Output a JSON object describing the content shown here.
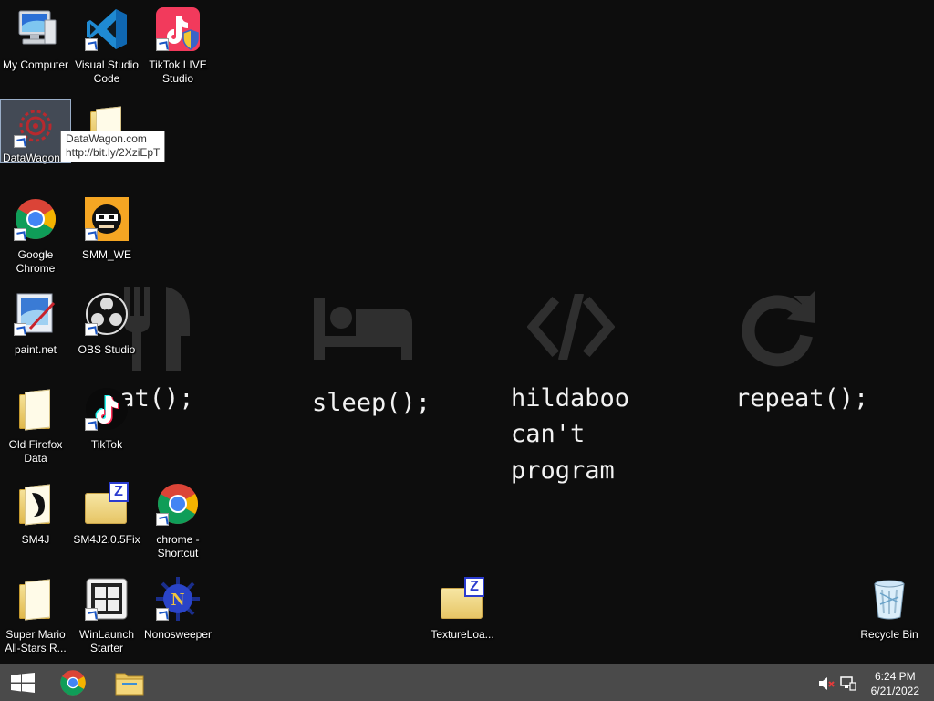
{
  "desktop": {
    "icons": [
      {
        "label": "My Computer",
        "icon": "my-computer-icon"
      },
      {
        "label": "Visual Studio Code",
        "icon": "vscode-icon"
      },
      {
        "label": "TikTok LIVE Studio",
        "icon": "tiktok-live-studio-icon"
      },
      {
        "label": "DataWagon",
        "icon": "datawagon-icon"
      },
      {
        "label": "",
        "icon": "folder-icon"
      },
      {
        "label": "Google Chrome",
        "icon": "chrome-icon"
      },
      {
        "label": "SMM_WE",
        "icon": "smm-we-icon"
      },
      {
        "label": "paint.net",
        "icon": "paint-net-icon"
      },
      {
        "label": "OBS Studio",
        "icon": "obs-studio-icon"
      },
      {
        "label": "Old Firefox Data",
        "icon": "folder-icon"
      },
      {
        "label": "TikTok",
        "icon": "tiktok-icon"
      },
      {
        "label": "SM4J",
        "icon": "folder-icon"
      },
      {
        "label": "SM4J2.0.5Fix",
        "icon": "zip-folder-icon"
      },
      {
        "label": "chrome - Shortcut",
        "icon": "chrome-icon"
      },
      {
        "label": "Super Mario All-Stars R...",
        "icon": "folder-icon"
      },
      {
        "label": "WinLaunch Starter",
        "icon": "winlaunch-icon"
      },
      {
        "label": "Nonosweeper",
        "icon": "nonosweeper-icon"
      },
      {
        "label": "TextureLoa...",
        "icon": "zip-folder-icon"
      },
      {
        "label": "Recycle Bin",
        "icon": "recycle-bin-icon"
      }
    ],
    "tooltip": {
      "line1": "DataWagon.com",
      "line2": "http://bit.ly/2XziEpT"
    }
  },
  "wallpaper": {
    "eat": "eat();",
    "sleep": "sleep();",
    "code_line1": "hildaboo",
    "code_line2": "can't",
    "code_line3": "program",
    "repeat": "repeat();",
    "icons": [
      "fork-knife-icon",
      "bed-icon",
      "code-icon",
      "refresh-icon"
    ]
  },
  "taskbar": {
    "buttons": [
      "windows-start-icon",
      "chrome-icon",
      "file-explorer-icon"
    ],
    "tray": [
      "speaker-muted-icon",
      "network-icon"
    ],
    "time": "6:24 PM",
    "date": "6/21/2022"
  },
  "colors": {
    "background": "#0d0d0d",
    "taskbar": "#4a4a4a",
    "wallpaper_icon": "#2f2f2f"
  }
}
